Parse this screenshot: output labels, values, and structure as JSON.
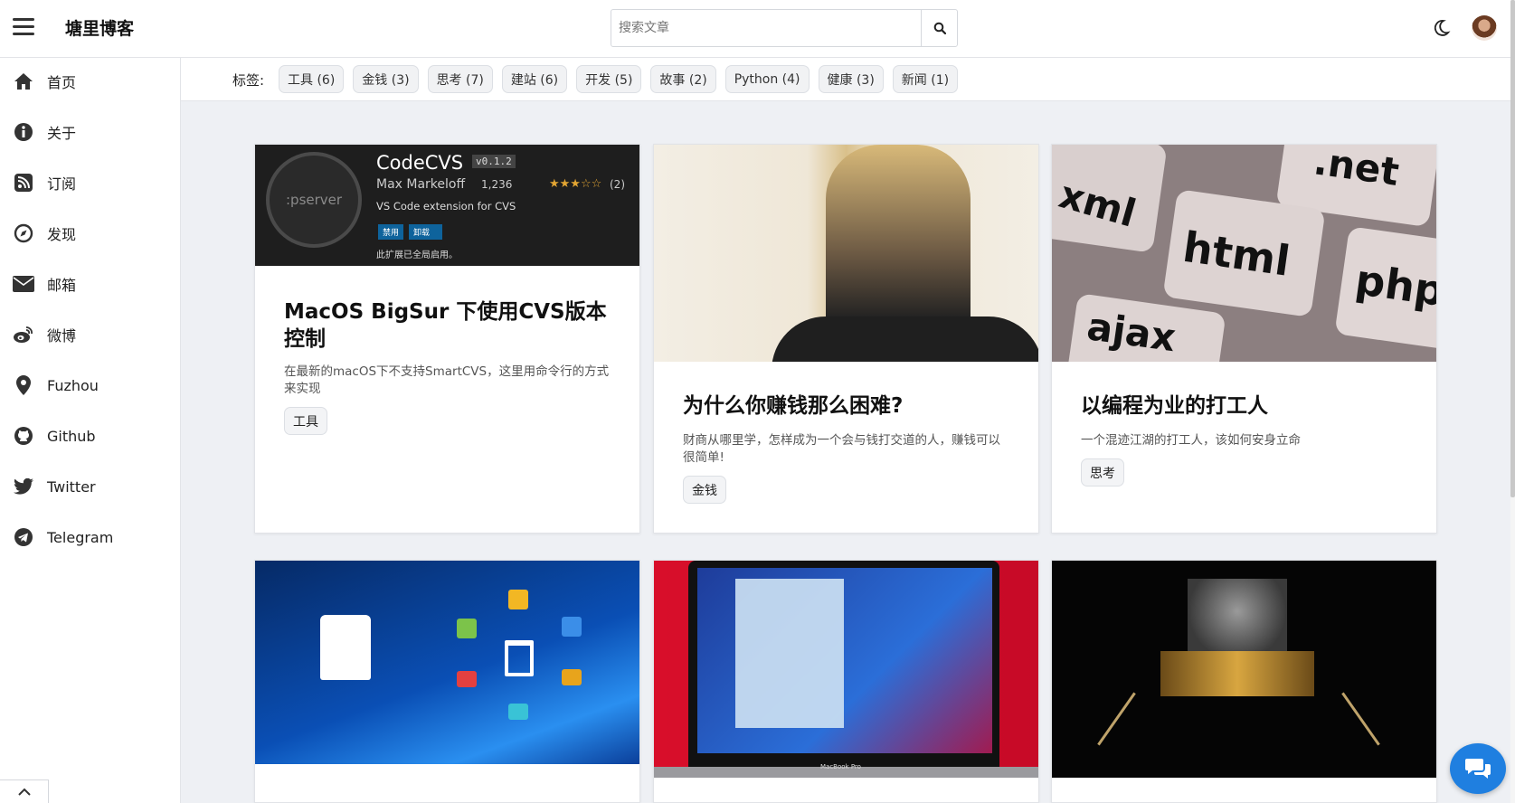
{
  "header": {
    "site_title": "塘里博客",
    "search_placeholder": "搜索文章",
    "icons": [
      "menu-icon",
      "search-icon",
      "moon-icon",
      "avatar"
    ]
  },
  "sidebar": {
    "items": [
      {
        "label": "首页",
        "icon": "home-icon"
      },
      {
        "label": "关于",
        "icon": "info-icon"
      },
      {
        "label": "订阅",
        "icon": "rss-icon"
      },
      {
        "label": "发现",
        "icon": "compass-icon"
      },
      {
        "label": "邮箱",
        "icon": "envelope-icon"
      },
      {
        "label": "微博",
        "icon": "weibo-icon"
      },
      {
        "label": "Fuzhou",
        "icon": "map-marker-icon"
      },
      {
        "label": "Github",
        "icon": "github-icon"
      },
      {
        "label": "Twitter",
        "icon": "twitter-icon"
      },
      {
        "label": "Telegram",
        "icon": "telegram-icon"
      }
    ]
  },
  "tagbar": {
    "label": "标签:",
    "tags": [
      "工具 (6)",
      "金钱 (3)",
      "思考 (7)",
      "建站 (6)",
      "开发 (5)",
      "故事 (2)",
      "Python (4)",
      "健康 (3)",
      "新闻 (1)"
    ]
  },
  "thumb_text": {
    "codecvs": {
      "name": "CodeCVS",
      "version": "v0.1.2",
      "author": "Max Markeloff",
      "installs": "1,236",
      "stars": "★★★☆☆",
      "rating_count": "(2)",
      "description": "VS Code extension for CVS",
      "btn_disable": "禁用",
      "btn_uninstall": "卸载",
      "status": "此扩展已全局启用。",
      "logo_text": ":pserver"
    },
    "keys": [
      ".net",
      "xml",
      "html",
      "php",
      "ajax"
    ],
    "laptop_brand": "MacBook Pro"
  },
  "posts": [
    {
      "title": "MacOS BigSur 下使用CVS版本控制",
      "desc": "在最新的macOS下不支持SmartCVS，这里用命令行的方式来实现",
      "tag": "工具"
    },
    {
      "title": "为什么你赚钱那么困难?",
      "desc": "财商从哪里学，怎样成为一个会与钱打交道的人，赚钱可以很简单!",
      "tag": "金钱"
    },
    {
      "title": "以编程为业的打工人",
      "desc": "一个混迹江湖的打工人，该如何安身立命",
      "tag": "思考"
    }
  ],
  "colors": {
    "accent": "#1f7fe0",
    "page_bg": "#eef0f4"
  }
}
